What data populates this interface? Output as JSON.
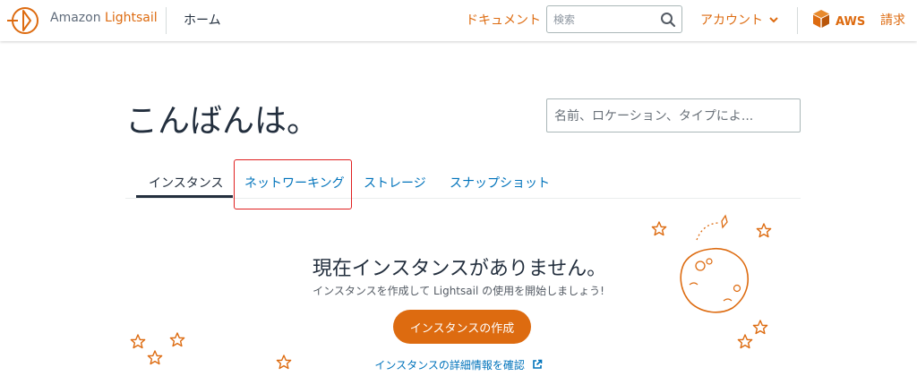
{
  "header": {
    "brand_prefix": "Amazon ",
    "brand_highlight": "Lightsail",
    "home_label": "ホーム",
    "docs_label": "ドキュメント",
    "search_placeholder": "検索",
    "account_label": "アカウント",
    "aws_label": "AWS",
    "billing_label": "請求"
  },
  "main": {
    "greeting": "こんばんは。",
    "filter_placeholder": "名前、ロケーション、タイプによ...",
    "tabs": [
      {
        "label": "インスタンス",
        "active": true
      },
      {
        "label": "ネットワーキング",
        "active": false
      },
      {
        "label": "ストレージ",
        "active": false
      },
      {
        "label": "スナップショット",
        "active": false
      }
    ],
    "empty": {
      "title": "現在インスタンスがありません。",
      "subtitle": "インスタンスを作成して Lightsail の使用を開始しましょう!",
      "create_button": "インスタンスの作成",
      "detail_link": "インスタンスの詳細情報を確認"
    }
  },
  "colors": {
    "accent": "#dd6b10",
    "link": "#0073bb",
    "text": "#232f3e",
    "highlight_box": "#e02020"
  },
  "icons": [
    "lightsail-logo-icon",
    "search-icon",
    "chevron-down-icon",
    "aws-cube-icon",
    "external-link-icon",
    "star-icon",
    "moon-icon"
  ]
}
